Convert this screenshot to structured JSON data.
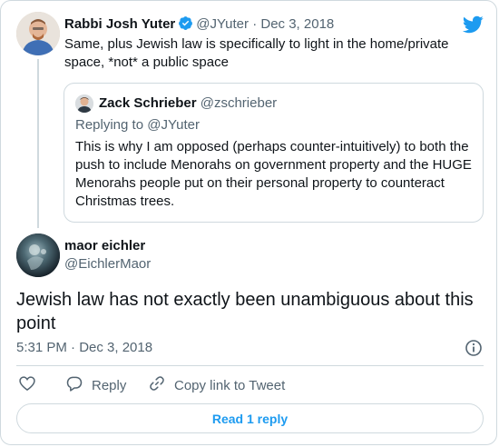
{
  "colors": {
    "accent": "#1d9bf0",
    "text": "#0f1419",
    "muted": "#536471",
    "border": "#cfd9de"
  },
  "parent_tweet": {
    "author_name": "Rabbi Josh Yuter",
    "handle": "@JYuter",
    "separator": "·",
    "date": "Dec 3, 2018",
    "text": "Same, plus Jewish law is specifically to light in the home/private space, *not* a public space",
    "verified_icon": "verified-badge-icon"
  },
  "quoted_tweet": {
    "author_name": "Zack Schrieber",
    "handle": "@zschrieber",
    "replying_to": "Replying to @JYuter",
    "text": "This is why I am opposed (perhaps counter-intuitively) to both the push to include Menorahs on government property and the HUGE Menorahs people put on their personal property to counteract Christmas trees."
  },
  "main_tweet": {
    "author_name": "maor eichler",
    "handle": "@EichlerMaor",
    "text": "Jewish law has not exactly been unambiguous about this point",
    "timestamp": "5:31 PM · Dec 3, 2018"
  },
  "actions": {
    "reply_label": "Reply",
    "copy_label": "Copy link to Tweet",
    "read_replies_label": "Read 1 reply"
  },
  "icons": [
    "twitter-bird-icon",
    "info-icon",
    "heart-icon",
    "reply-bubble-icon",
    "link-icon"
  ]
}
